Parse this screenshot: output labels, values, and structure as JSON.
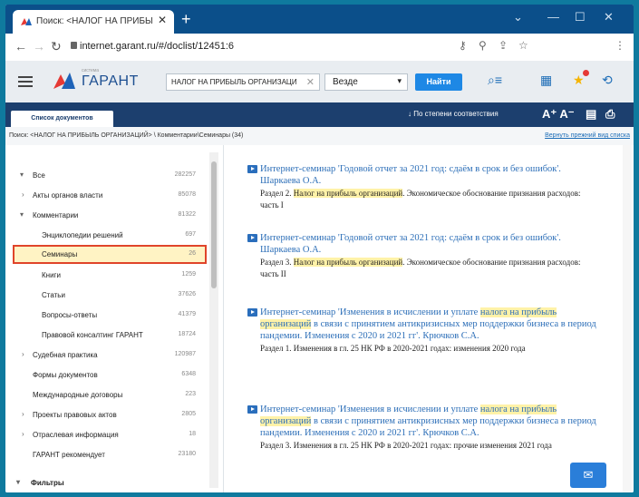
{
  "browser": {
    "tab_title": "Поиск: <НАЛОГ НА ПРИБЫЛЬ О",
    "tab_close": "✕",
    "new_tab": "+",
    "url": "internet.garant.ru/#/doclist/12451:6"
  },
  "header": {
    "logo_small": "система",
    "logo_text": "ГАРАНТ",
    "search_query": "НАЛОГ НА ПРИБЫЛЬ ОРГАНИЗАЦИ",
    "search_clear": "✕",
    "scope": "Везде",
    "find_button": "Найти"
  },
  "toolbar": {
    "doc_list_tab": "Список документов",
    "sort_label": "По степени соответствия",
    "font_size": "A⁺ A⁻"
  },
  "breadcrumb": {
    "path": "Поиск: <НАЛОГ НА ПРИБЫЛЬ ОРГАНИЗАЦИЙ> \\ Комментарии\\Семинары (34)",
    "back_link": "Вернуть прежний вид списка"
  },
  "tree": {
    "items": [
      {
        "label": "Все",
        "count": "282257",
        "arrow": "▾"
      },
      {
        "label": "Акты органов власти",
        "count": "85078",
        "arrow": "›"
      },
      {
        "label": "Комментарии",
        "count": "81322",
        "arrow": "▾"
      },
      {
        "label": "Энциклопедии решений",
        "count": "697",
        "arrow": ""
      },
      {
        "label": "Семинары",
        "count": "26",
        "arrow": ""
      },
      {
        "label": "Книги",
        "count": "1259",
        "arrow": ""
      },
      {
        "label": "Статьи",
        "count": "37626",
        "arrow": ""
      },
      {
        "label": "Вопросы-ответы",
        "count": "41379",
        "arrow": ""
      },
      {
        "label": "Правовой консалтинг ГАРАНТ",
        "count": "18724",
        "arrow": ""
      },
      {
        "label": "Судебная практика",
        "count": "120987",
        "arrow": "›"
      },
      {
        "label": "Формы документов",
        "count": "6348",
        "arrow": ""
      },
      {
        "label": "Международные договоры",
        "count": "223",
        "arrow": ""
      },
      {
        "label": "Проекты правовых актов",
        "count": "2805",
        "arrow": "›"
      },
      {
        "label": "Отраслевая информация",
        "count": "18",
        "arrow": "›"
      },
      {
        "label": "ГАРАНТ рекомендует",
        "count": "23180",
        "arrow": ""
      }
    ],
    "filters": "Фильтры"
  },
  "results": [
    {
      "title": "Интернет-семинар 'Годовой отчет за 2021 год: сдаём в срок и без ошибок'. Шаркаева О.А.",
      "d_pre": "Раздел 2. ",
      "d_hl": "Налог на прибыль организаций",
      "d_post": ". Экономическое обоснование признания расходов: часть I"
    },
    {
      "title": "Интернет-семинар 'Годовой отчет за 2021 год: сдаём в срок и без ошибок'. Шаркаева О.А.",
      "d_pre": "Раздел 3. ",
      "d_hl": "Налог на прибыль организаций",
      "d_post": ". Экономическое обоснование признания расходов: часть II"
    },
    {
      "t_pre": "Интернет-семинар 'Изменения в исчислении и уплате ",
      "t_hl": "налога на прибыль организаций",
      "t_post": " в связи с принятием антикризисных мер поддержки бизнеса в период пандемии. Изменения с 2020 и 2021 гг'. Крючков С.А.",
      "desc": "Раздел 1. Изменения в гл. 25 НК РФ в 2020-2021 годах: изменения 2020 года"
    },
    {
      "t_pre": "Интернет-семинар 'Изменения в исчислении и уплате ",
      "t_hl": "налога на прибыль организаций",
      "t_post": " в связи с принятием антикризисных мер поддержки бизнеса в период пандемии. Изменения с 2020 и 2021 гг'. Крючков С.А.",
      "desc": "Раздел 3. Изменения в гл. 25 НК РФ в 2020-2021 годах: прочие изменения 2021 года"
    }
  ],
  "colors": {
    "background": "#0f7a9e",
    "toolbar": "#1c3f6e",
    "accent": "#1e88e5",
    "selection_outline": "#e0442a",
    "highlight": "#fff2a8"
  }
}
